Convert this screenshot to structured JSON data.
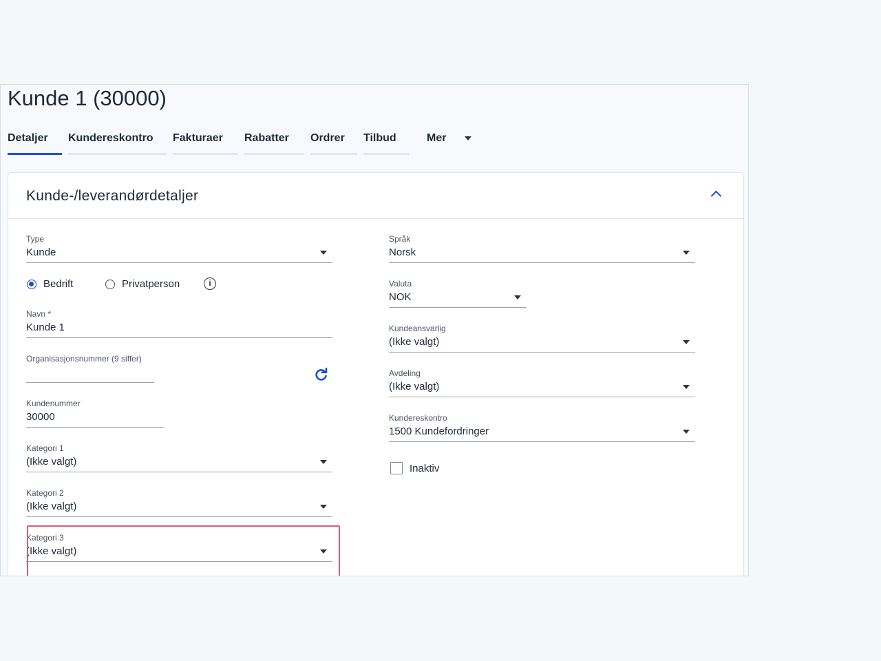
{
  "page": {
    "title": "Kunde 1 (30000)"
  },
  "tabs": [
    {
      "label": "Detaljer",
      "active": true
    },
    {
      "label": "Kundereskontro",
      "active": false
    },
    {
      "label": "Fakturaer",
      "active": false
    },
    {
      "label": "Rabatter",
      "active": false
    },
    {
      "label": "Ordrer",
      "active": false
    },
    {
      "label": "Tilbud",
      "active": false
    },
    {
      "label": "Mer",
      "active": false
    }
  ],
  "card": {
    "title": "Kunde-/leverandørdetaljer"
  },
  "left": {
    "type": {
      "label": "Type",
      "value": "Kunde"
    },
    "company_type": {
      "option1": "Bedrift",
      "option2": "Privatperson",
      "selected": "Bedrift"
    },
    "name": {
      "label": "Navn *",
      "value": "Kunde 1"
    },
    "org_number": {
      "label": "Organisasjonsnummer (9 siffer)",
      "value": ""
    },
    "customer_number": {
      "label": "Kundenummer",
      "value": "30000"
    },
    "category1": {
      "label": "Kategori 1",
      "value": "(Ikke valgt)"
    },
    "category2": {
      "label": "Kategori 2",
      "value": "(Ikke valgt)"
    },
    "category3": {
      "label": "Kategori 3",
      "value": "(Ikke valgt)"
    }
  },
  "right": {
    "language": {
      "label": "Språk",
      "value": "Norsk"
    },
    "currency": {
      "label": "Valuta",
      "value": "NOK"
    },
    "account_manager": {
      "label": "Kundeansvarlig",
      "value": "(Ikke valgt)"
    },
    "department": {
      "label": "Avdeling",
      "value": "(Ikke valgt)"
    },
    "ledger": {
      "label": "Kundereskontro",
      "value": "1500 Kundefordringer"
    },
    "inactive": {
      "label": "Inaktiv",
      "checked": false
    }
  },
  "colors": {
    "accent": "#1b4fcf",
    "highlight": "#e05a6d",
    "background": "#f3f8f8"
  }
}
